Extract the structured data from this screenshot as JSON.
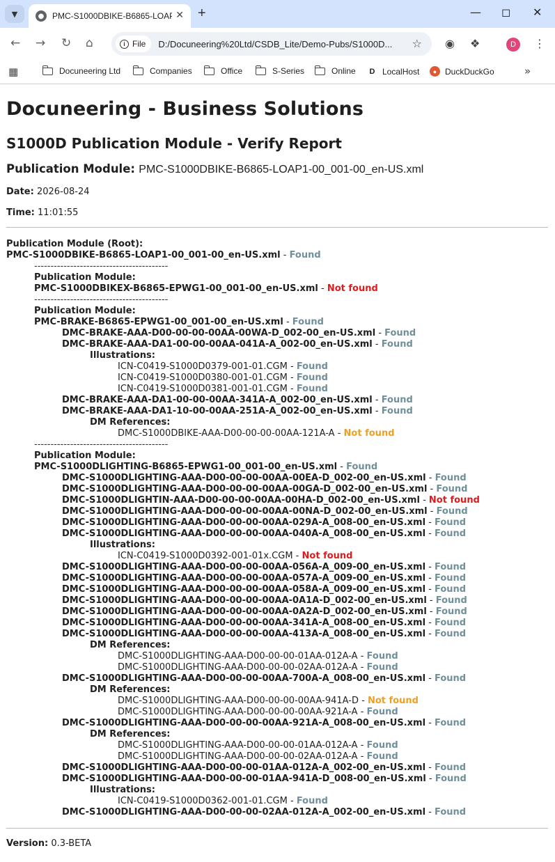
{
  "browser": {
    "tab_title": "PMC-S1000DBIKE-B6865-LOAP",
    "file_chip": "File",
    "url": "D:/Docuneering%20Ltd/CSDB_Lite/Demo-Pubs/S1000D...",
    "profile_initial": "D",
    "bookmarks": [
      "Docuneering Ltd",
      "Companies",
      "Office",
      "S-Series",
      "Online",
      "LocalHost",
      "DuckDuckGo"
    ]
  },
  "page": {
    "title": "Docuneering - Business Solutions",
    "subtitle": "S1000D Publication Module - Verify Report",
    "pm_label": "Publication Module:",
    "pm_file": "PMC-S1000DBIKE-B6865-LOAP1-00_001-00_en-US.xml",
    "date_label": "Date:",
    "date_value": "2026-08-24",
    "time_label": "Time:",
    "time_value": "11:01:55",
    "version_label": "Version:",
    "version_value": "0.3-BETA",
    "separator": "-----------------------------------------"
  },
  "status_colors": {
    "found": "#6f8f9a",
    "not_found": "#e01b1b",
    "ref_not_found": "#f0a020"
  },
  "report": [
    {
      "indent": 0,
      "bold": true,
      "text": "Publication Module (Root):"
    },
    {
      "indent": 0,
      "bold": true,
      "text": "PMC-S1000DBIKE-B6865-LOAP1-00_001-00_en-US.xml",
      "status": "Found",
      "status_class": "ok"
    },
    {
      "indent": 1,
      "bold": false,
      "sep": true,
      "text": "-----------------------------------------"
    },
    {
      "indent": 1,
      "bold": true,
      "text": "Publication Module:"
    },
    {
      "indent": 1,
      "bold": true,
      "text": "PMC-S1000DBIKEX-B6865-EPWG1-00_001-00_en-US.xml",
      "status": "Not found",
      "status_class": "nf"
    },
    {
      "indent": 1,
      "bold": false,
      "sep": true,
      "text": "-----------------------------------------"
    },
    {
      "indent": 1,
      "bold": true,
      "text": "Publication Module:"
    },
    {
      "indent": 1,
      "bold": true,
      "text": "PMC-BRAKE-B6865-EPWG1-00_001-00_en-US.xml",
      "status": "Found",
      "status_class": "ok"
    },
    {
      "indent": 2,
      "bold": true,
      "text": "DMC-BRAKE-AAA-D00-00-00-00AA-00WA-D_002-00_en-US.xml",
      "status": "Found",
      "status_class": "ok"
    },
    {
      "indent": 2,
      "bold": true,
      "text": "DMC-BRAKE-AAA-DA1-00-00-00AA-041A-A_002-00_en-US.xml",
      "status": "Found",
      "status_class": "ok"
    },
    {
      "indent": 3,
      "bold": true,
      "text": "Illustrations:"
    },
    {
      "indent": 4,
      "bold": false,
      "text": "ICN-C0419-S1000D0379-001-01.CGM",
      "status": "Found",
      "status_class": "ok"
    },
    {
      "indent": 4,
      "bold": false,
      "text": "ICN-C0419-S1000D0380-001-01.CGM",
      "status": "Found",
      "status_class": "ok"
    },
    {
      "indent": 4,
      "bold": false,
      "text": "ICN-C0419-S1000D0381-001-01.CGM",
      "status": "Found",
      "status_class": "ok"
    },
    {
      "indent": 2,
      "bold": true,
      "text": "DMC-BRAKE-AAA-DA1-00-00-00AA-341A-A_002-00_en-US.xml",
      "status": "Found",
      "status_class": "ok"
    },
    {
      "indent": 2,
      "bold": true,
      "text": "DMC-BRAKE-AAA-DA1-10-00-00AA-251A-A_002-00_en-US.xml",
      "status": "Found",
      "status_class": "ok"
    },
    {
      "indent": 3,
      "bold": true,
      "text": "DM References:"
    },
    {
      "indent": 4,
      "bold": false,
      "text": "DMC-S1000DBIKE-AAA-D00-00-00-00AA-121A-A",
      "status": "Not found",
      "status_class": "nfw"
    },
    {
      "indent": 1,
      "bold": false,
      "sep": true,
      "text": "-----------------------------------------"
    },
    {
      "indent": 1,
      "bold": true,
      "text": "Publication Module:"
    },
    {
      "indent": 1,
      "bold": true,
      "text": "PMC-S1000DLIGHTING-B6865-EPWG1-00_001-00_en-US.xml",
      "status": "Found",
      "status_class": "ok"
    },
    {
      "indent": 2,
      "bold": true,
      "text": "DMC-S1000DLIGHTING-AAA-D00-00-00-00AA-00EA-D_002-00_en-US.xml",
      "status": "Found",
      "status_class": "ok"
    },
    {
      "indent": 2,
      "bold": true,
      "text": "DMC-S1000DLIGHTING-AAA-D00-00-00-00AA-00GA-D_002-00_en-US.xml",
      "status": "Found",
      "status_class": "ok"
    },
    {
      "indent": 2,
      "bold": true,
      "text": "DMC-S1000DLIGHTIN-AAA-D00-00-00-00AA-00HA-D_002-00_en-US.xml",
      "status": "Not found",
      "status_class": "nf"
    },
    {
      "indent": 2,
      "bold": true,
      "text": "DMC-S1000DLIGHTING-AAA-D00-00-00-00AA-00NA-D_002-00_en-US.xml",
      "status": "Found",
      "status_class": "ok"
    },
    {
      "indent": 2,
      "bold": true,
      "text": "DMC-S1000DLIGHTING-AAA-D00-00-00-00AA-029A-A_008-00_en-US.xml",
      "status": "Found",
      "status_class": "ok"
    },
    {
      "indent": 2,
      "bold": true,
      "text": "DMC-S1000DLIGHTING-AAA-D00-00-00-00AA-040A-A_008-00_en-US.xml",
      "status": "Found",
      "status_class": "ok"
    },
    {
      "indent": 3,
      "bold": true,
      "text": "Illustrations:"
    },
    {
      "indent": 4,
      "bold": false,
      "text": "ICN-C0419-S1000D0392-001-01x.CGM",
      "status": "Not found",
      "status_class": "nf"
    },
    {
      "indent": 2,
      "bold": true,
      "text": "DMC-S1000DLIGHTING-AAA-D00-00-00-00AA-056A-A_009-00_en-US.xml",
      "status": "Found",
      "status_class": "ok"
    },
    {
      "indent": 2,
      "bold": true,
      "text": "DMC-S1000DLIGHTING-AAA-D00-00-00-00AA-057A-A_009-00_en-US.xml",
      "status": "Found",
      "status_class": "ok"
    },
    {
      "indent": 2,
      "bold": true,
      "text": "DMC-S1000DLIGHTING-AAA-D00-00-00-00AA-058A-A_009-00_en-US.xml",
      "status": "Found",
      "status_class": "ok"
    },
    {
      "indent": 2,
      "bold": true,
      "text": "DMC-S1000DLIGHTING-AAA-D00-00-00-00AA-0A1A-D_002-00_en-US.xml",
      "status": "Found",
      "status_class": "ok"
    },
    {
      "indent": 2,
      "bold": true,
      "text": "DMC-S1000DLIGHTING-AAA-D00-00-00-00AA-0A2A-D_002-00_en-US.xml",
      "status": "Found",
      "status_class": "ok"
    },
    {
      "indent": 2,
      "bold": true,
      "text": "DMC-S1000DLIGHTING-AAA-D00-00-00-00AA-341A-A_008-00_en-US.xml",
      "status": "Found",
      "status_class": "ok"
    },
    {
      "indent": 2,
      "bold": true,
      "text": "DMC-S1000DLIGHTING-AAA-D00-00-00-00AA-413A-A_008-00_en-US.xml",
      "status": "Found",
      "status_class": "ok"
    },
    {
      "indent": 3,
      "bold": true,
      "text": "DM References:"
    },
    {
      "indent": 4,
      "bold": false,
      "text": "DMC-S1000DLIGHTING-AAA-D00-00-00-01AA-012A-A",
      "status": "Found",
      "status_class": "ok"
    },
    {
      "indent": 4,
      "bold": false,
      "text": "DMC-S1000DLIGHTING-AAA-D00-00-00-02AA-012A-A",
      "status": "Found",
      "status_class": "ok"
    },
    {
      "indent": 2,
      "bold": true,
      "text": "DMC-S1000DLIGHTING-AAA-D00-00-00-00AA-700A-A_008-00_en-US.xml",
      "status": "Found",
      "status_class": "ok"
    },
    {
      "indent": 3,
      "bold": true,
      "text": "DM References:"
    },
    {
      "indent": 4,
      "bold": false,
      "text": "DMC-S1000DLIGHTING-AAA-D00-00-00-00AA-941A-D",
      "status": "Not found",
      "status_class": "nfw"
    },
    {
      "indent": 4,
      "bold": false,
      "text": "DMC-S1000DLIGHTING-AAA-D00-00-00-00AA-921A-A",
      "status": "Found",
      "status_class": "ok"
    },
    {
      "indent": 2,
      "bold": true,
      "text": "DMC-S1000DLIGHTING-AAA-D00-00-00-00AA-921A-A_008-00_en-US.xml",
      "status": "Found",
      "status_class": "ok"
    },
    {
      "indent": 3,
      "bold": true,
      "text": "DM References:"
    },
    {
      "indent": 4,
      "bold": false,
      "text": "DMC-S1000DLIGHTING-AAA-D00-00-00-01AA-012A-A",
      "status": "Found",
      "status_class": "ok"
    },
    {
      "indent": 4,
      "bold": false,
      "text": "DMC-S1000DLIGHTING-AAA-D00-00-00-02AA-012A-A",
      "status": "Found",
      "status_class": "ok"
    },
    {
      "indent": 2,
      "bold": true,
      "text": "DMC-S1000DLIGHTING-AAA-D00-00-00-01AA-012A-A_002-00_en-US.xml",
      "status": "Found",
      "status_class": "ok"
    },
    {
      "indent": 2,
      "bold": true,
      "text": "DMC-S1000DLIGHTING-AAA-D00-00-00-01AA-941A-D_008-00_en-US.xml",
      "status": "Found",
      "status_class": "ok"
    },
    {
      "indent": 3,
      "bold": true,
      "text": "Illustrations:"
    },
    {
      "indent": 4,
      "bold": false,
      "text": "ICN-C0419-S1000D0362-001-01.CGM",
      "status": "Found",
      "status_class": "ok"
    },
    {
      "indent": 2,
      "bold": true,
      "text": "DMC-S1000DLIGHTING-AAA-D00-00-00-02AA-012A-A_002-00_en-US.xml",
      "status": "Found",
      "status_class": "ok"
    }
  ]
}
